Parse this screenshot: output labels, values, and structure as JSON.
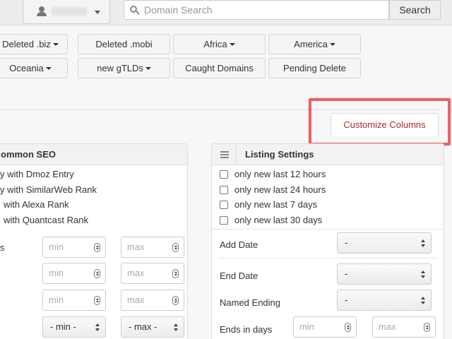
{
  "topbar": {
    "search_placeholder": "Domain Search",
    "search_button": "Search"
  },
  "tld_buttons": {
    "row1": [
      "Deleted .biz",
      "Deleted .mobi",
      "Africa",
      "America"
    ],
    "row2": [
      "Oceania",
      "new gTLDs",
      "Caught Domains",
      "Pending Delete"
    ]
  },
  "tabs": {
    "customize_columns": "Customize Columns"
  },
  "common_seo": {
    "title": "ommon SEO",
    "checks": [
      "y with Dmoz Entry",
      "y with SimilarWeb Rank",
      "with Alexa Rank",
      "with Quantcast Rank"
    ],
    "row1_label": "s",
    "min_placeholder": "min",
    "max_placeholder": "max",
    "select_min": "- min -",
    "select_max": "- max -"
  },
  "listing_settings": {
    "title": "Listing Settings",
    "checks": [
      "only new last 12 hours",
      "only new last 24 hours",
      "only new last 7 days",
      "only new last 30 days"
    ],
    "add_date_label": "Add Date",
    "end_date_label": "End Date",
    "named_ending_label": "Named Ending",
    "ends_in_days_label": "Ends in days",
    "select_default": "-",
    "min_placeholder": "min",
    "max_placeholder": "max"
  },
  "colors": {
    "accent_red": "#b0282b",
    "highlight": "#ef5f63"
  }
}
